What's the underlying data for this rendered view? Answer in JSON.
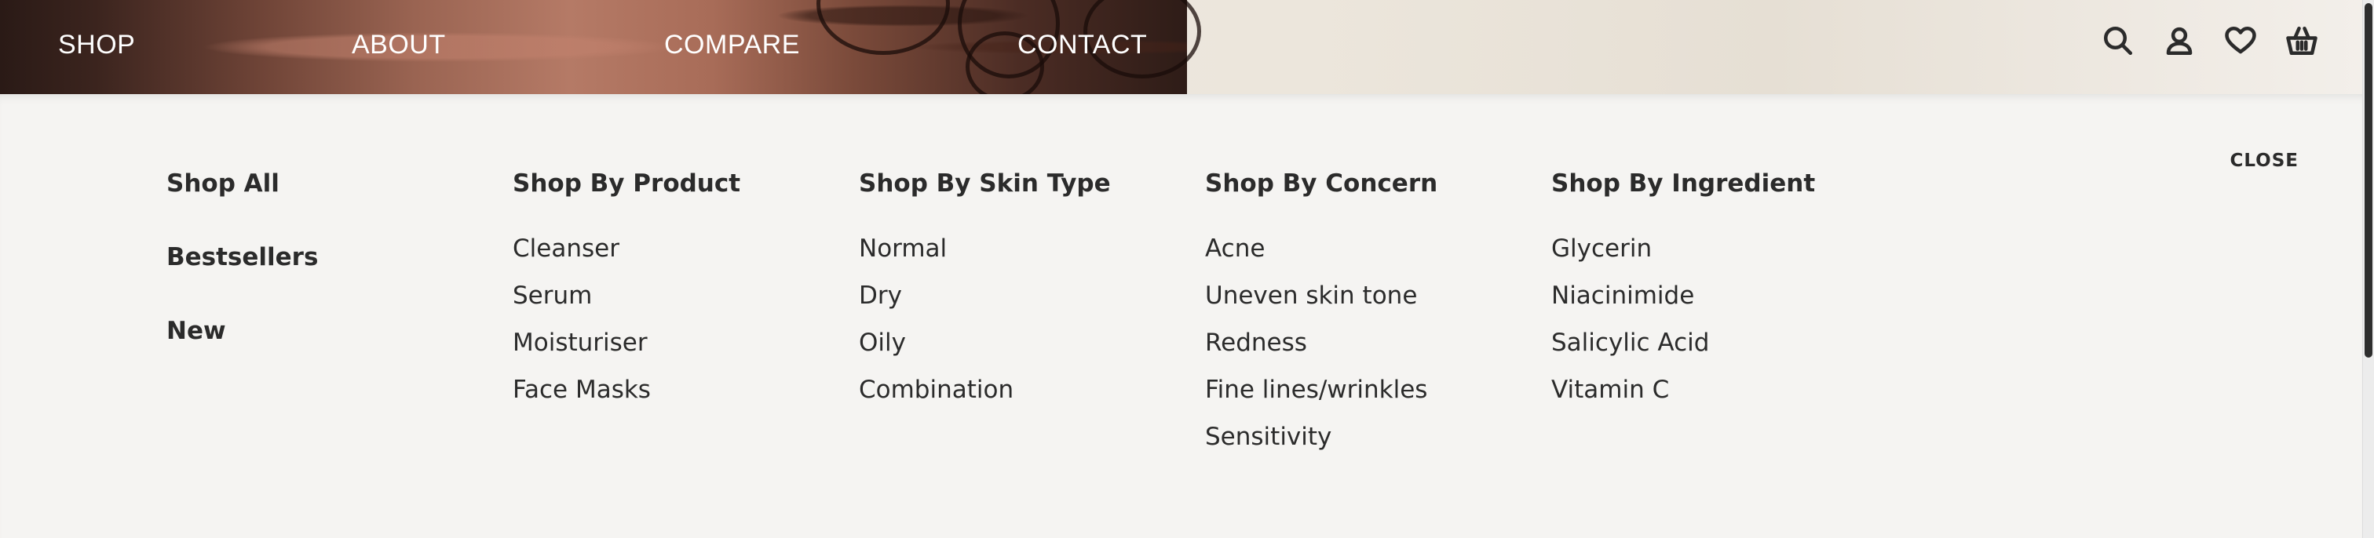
{
  "nav": {
    "links": [
      "SHOP",
      "ABOUT",
      "COMPARE",
      "CONTACT"
    ]
  },
  "header_icons": [
    "search-icon",
    "account-icon",
    "wishlist-heart-icon",
    "basket-icon"
  ],
  "menu": {
    "close_label": "CLOSE",
    "shop_links": [
      "Shop All",
      "Bestsellers",
      "New"
    ],
    "columns": [
      {
        "title": "Shop By Product",
        "items": [
          "Cleanser",
          "Serum",
          "Moisturiser",
          "Face Masks"
        ]
      },
      {
        "title": "Shop By Skin Type",
        "items": [
          "Normal",
          "Dry",
          "Oily",
          "Combination"
        ]
      },
      {
        "title": "Shop By Concern",
        "items": [
          "Acne",
          "Uneven skin tone",
          "Redness",
          "Fine lines/wrinkles",
          "Sensitivity"
        ]
      },
      {
        "title": "Shop By Ingredient",
        "items": [
          "Glycerin",
          "Niacinimide",
          "Salicylic Acid",
          "Vitamin C"
        ]
      }
    ]
  },
  "colors": {
    "menu_bg": "#f5f4f2",
    "text": "#2b2b2b",
    "nav_text": "#ffffff"
  }
}
